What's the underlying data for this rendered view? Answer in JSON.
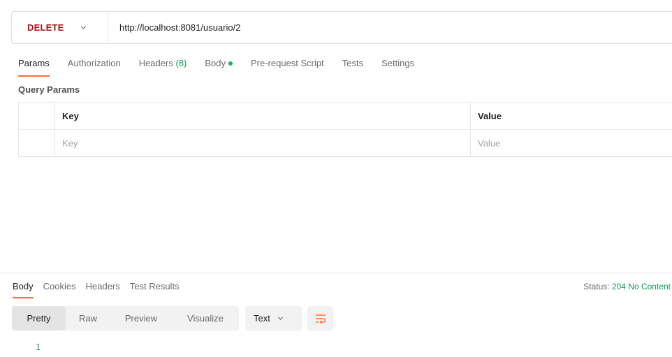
{
  "request": {
    "method": "DELETE",
    "url": "http://localhost:8081/usuario/2"
  },
  "request_tabs": [
    {
      "label": "Params",
      "active": true
    },
    {
      "label": "Authorization"
    },
    {
      "label": "Headers",
      "count": "(8)"
    },
    {
      "label": "Body",
      "dot": true
    },
    {
      "label": "Pre-request Script"
    },
    {
      "label": "Tests"
    },
    {
      "label": "Settings"
    }
  ],
  "query_params": {
    "title": "Query Params",
    "headers": {
      "key": "Key",
      "value": "Value"
    },
    "placeholder": {
      "key": "Key",
      "value": "Value"
    }
  },
  "response": {
    "tabs": [
      {
        "label": "Body",
        "active": true
      },
      {
        "label": "Cookies"
      },
      {
        "label": "Headers"
      },
      {
        "label": "Test Results"
      }
    ],
    "status_label": "Status:",
    "status_value": "204 No Content",
    "view_modes": [
      {
        "label": "Pretty",
        "active": true
      },
      {
        "label": "Raw"
      },
      {
        "label": "Preview"
      },
      {
        "label": "Visualize"
      }
    ],
    "format": "Text",
    "line_number": "1"
  },
  "colors": {
    "method": "#a61414",
    "accent": "#ff6c37",
    "success": "#0f9a52"
  },
  "icons": {
    "dropdown": "chevron-down-icon",
    "wrap": "word-wrap-icon"
  }
}
